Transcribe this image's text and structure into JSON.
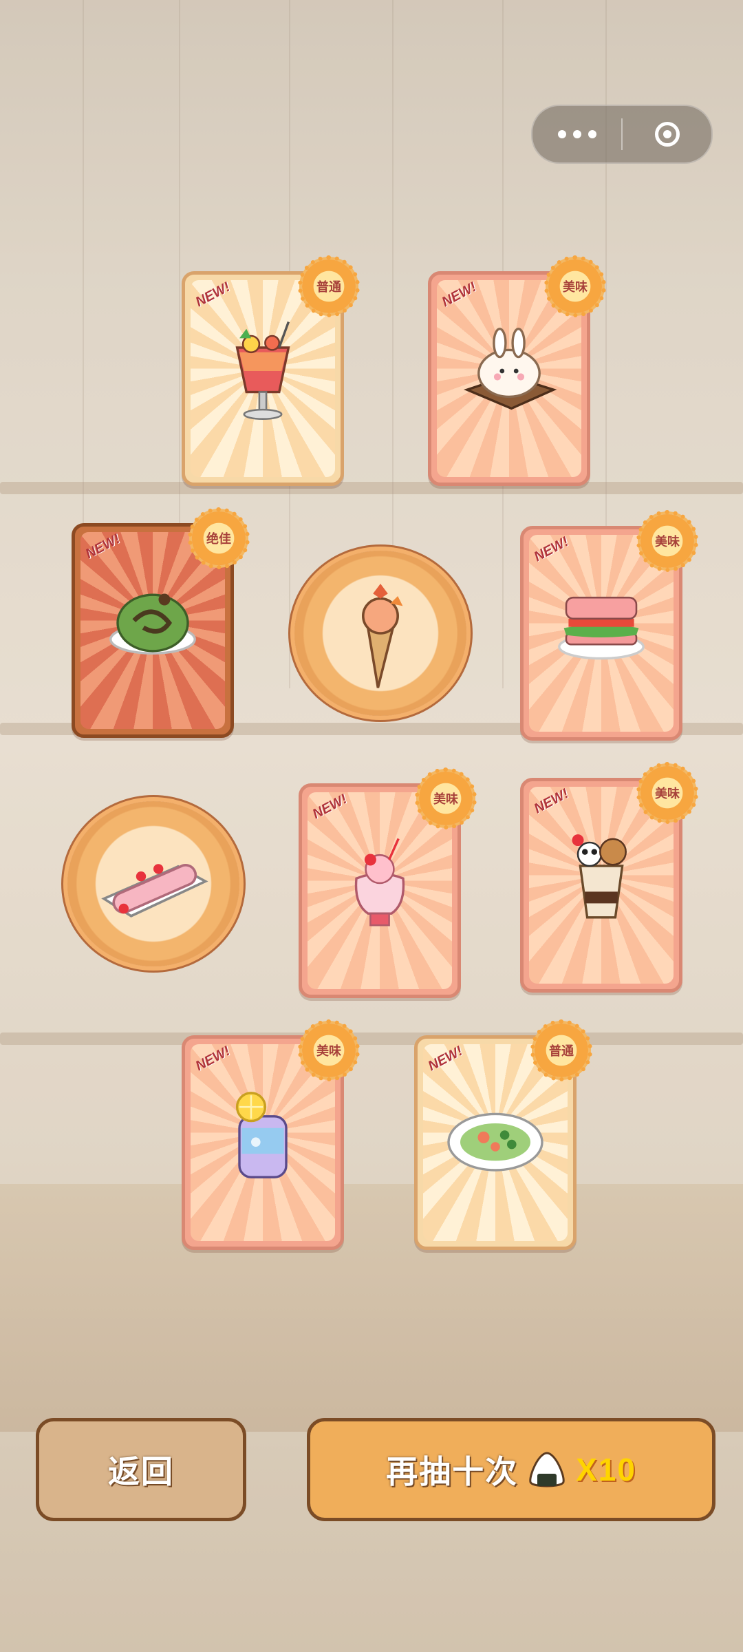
{
  "capsule": {
    "more_icon": "more-dots-icon",
    "close_icon": "target-circle-icon"
  },
  "cards": [
    {
      "new_label": "NEW!",
      "rarity": "普通",
      "food": "fruit-punch-glass",
      "style": "yellow"
    },
    {
      "new_label": "NEW!",
      "rarity": "美味",
      "food": "bunny-roll-cake",
      "style": "pink"
    },
    {
      "new_label": "NEW!",
      "rarity": "绝佳",
      "food": "matcha-roll-cake",
      "style": "brown"
    },
    {
      "new_label": "NEW!",
      "rarity": "美味",
      "food": "pink-sandwich",
      "style": "pink"
    },
    {
      "new_label": "NEW!",
      "rarity": "美味",
      "food": "strawberry-float",
      "style": "pink"
    },
    {
      "new_label": "NEW!",
      "rarity": "美味",
      "food": "panda-parfait",
      "style": "pink"
    },
    {
      "new_label": "NEW!",
      "rarity": "美味",
      "food": "galaxy-lemon-soda",
      "style": "pink"
    },
    {
      "new_label": "NEW!",
      "rarity": "普通",
      "food": "salad-plate",
      "style": "yellow"
    }
  ],
  "bubbles": [
    {
      "food": "maple-ice-cream-cone"
    },
    {
      "food": "strawberry-swiss-roll"
    }
  ],
  "buttons": {
    "back_label": "返回",
    "draw_label": "再抽十次",
    "currency_icon": "rice-ball-icon",
    "multiplier": "X10"
  }
}
